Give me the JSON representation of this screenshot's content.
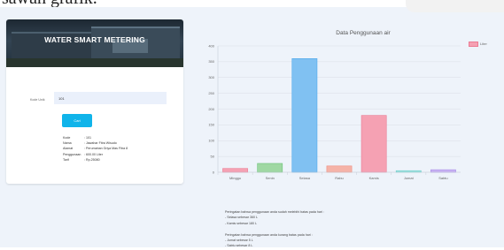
{
  "page_caption": "sawah grafik.",
  "app": {
    "title": "WATER SMART METERING",
    "input_label": "Kode Unik",
    "input_value": "101",
    "search_button": "Cari"
  },
  "info": [
    {
      "label": "Kode",
      "sep": ":",
      "value": "101"
    },
    {
      "label": "Nama",
      "sep": ":",
      "value": "Jawahar Fitra Wisudo"
    },
    {
      "label": "Alamat",
      "sep": ":",
      "value": "Perumahan Griya Mas Fitra 8"
    },
    {
      "label": "Penggunaan",
      "sep": ":",
      "value": "600.00 Liter"
    },
    {
      "label": "Tarif",
      "sep": ":",
      "value": "Rp.25080"
    }
  ],
  "chart_data": {
    "type": "bar",
    "title": "Data Penggunaan air",
    "categories": [
      "Minggu",
      "Senin",
      "Selasa",
      "Rabu",
      "Kamis",
      "Jumat",
      "Sabtu"
    ],
    "series": [
      {
        "name": "Liter",
        "values": [
          12,
          28,
          360,
          20,
          180,
          5,
          8
        ]
      }
    ],
    "ylim": [
      0,
      400
    ],
    "yticks": [
      0,
      50,
      100,
      150,
      200,
      250,
      300,
      350,
      400
    ],
    "grid": true,
    "legend": "top-right",
    "bar_colors": [
      "#f5a1b3",
      "#9fd8a3",
      "#80c1f2",
      "#f5b3a8",
      "#f5a1b3",
      "#9fe3e0",
      "#c9b3f2"
    ],
    "bar_borders": [
      "#ec7b93",
      "#6dc47a",
      "#4fa8ea",
      "#ee8f80",
      "#ec7b93",
      "#66ccc8",
      "#a78be8"
    ]
  },
  "notes": {
    "above_lines": [
      "Peringatan bahwa penggunaan anda sudah melebihi batas pada hari :",
      "- Selasa sebesar 360 L",
      "- Kamis sebesar 180 L"
    ],
    "below_lines": [
      "Peringatan bahwa penggunaan anda kurang batas pada hari :",
      "- Jumat sebesar 5 L",
      "- Sabtu sebesar 8 L"
    ]
  }
}
